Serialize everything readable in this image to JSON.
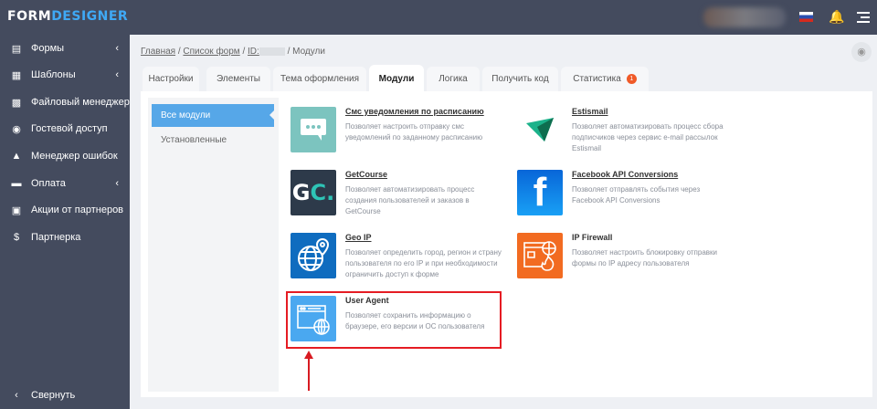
{
  "header": {
    "logo_part1": "FORM",
    "logo_part2": "DESIGNER",
    "icons": [
      "russia-flag-icon",
      "bell-icon",
      "menu-icon"
    ]
  },
  "sidebar": {
    "items": [
      {
        "label": "Формы",
        "icon": "form-icon",
        "chevron": true
      },
      {
        "label": "Шаблоны",
        "icon": "template-icon",
        "chevron": true
      },
      {
        "label": "Файловый менеджер",
        "icon": "folder-icon",
        "chevron": false
      },
      {
        "label": "Гостевой доступ",
        "icon": "user-icon",
        "chevron": false
      },
      {
        "label": "Менеджер ошибок",
        "icon": "warning-icon",
        "chevron": false
      },
      {
        "label": "Оплата",
        "icon": "card-icon",
        "chevron": true
      },
      {
        "label": "Акции от партнеров",
        "icon": "gift-icon",
        "chevron": false
      },
      {
        "label": "Партнерка",
        "icon": "dollar-icon",
        "chevron": false
      }
    ],
    "collapse": "Свернуть"
  },
  "breadcrumb": {
    "home": "Главная",
    "forms": "Список форм",
    "id": "ID:",
    "current": "/ Модули"
  },
  "tabs": [
    "Настройки",
    "Элементы",
    "Тема оформления",
    "Модули",
    "Логика",
    "Получить код",
    "Статистика"
  ],
  "stats_badge": "1",
  "filters": [
    "Все модули",
    "Установленные"
  ],
  "modules": [
    {
      "title": "Смс уведомления по расписанию",
      "desc": "Позволяет настроить отправку смс уведомлений по заданному расписанию",
      "color": "#7cc4bf"
    },
    {
      "title": "Estismail",
      "desc": "Позволяет автоматизировать процесс сбора подписчиков через сервис e-mail рассылок Estismail",
      "color": "#ffffff"
    },
    {
      "title": "GetCourse",
      "desc": "Позволяет автоматизировать процесс создания пользователей и заказов в GetCourse",
      "color": "#2d3a4a"
    },
    {
      "title": "Facebook API Conversions",
      "desc": "Позволяет отправлять события через Facebook API Conversions",
      "color": "#1877f2"
    },
    {
      "title": "Geo IP",
      "desc": "Позволяет определить город, регион и страну пользователя по его IP и при необходимости ограничить доступ к форме",
      "color": "#0f6cbf"
    },
    {
      "title": "IP Firewall",
      "desc": "Позволяет настроить блокировку отправки формы по IP адресу пользователя",
      "color": "#f26b21"
    },
    {
      "title": "User Agent",
      "desc": "Позволяет сохранить информацию о браузере, его версии и ОС пользователя",
      "color": "#4aa8f0"
    }
  ]
}
